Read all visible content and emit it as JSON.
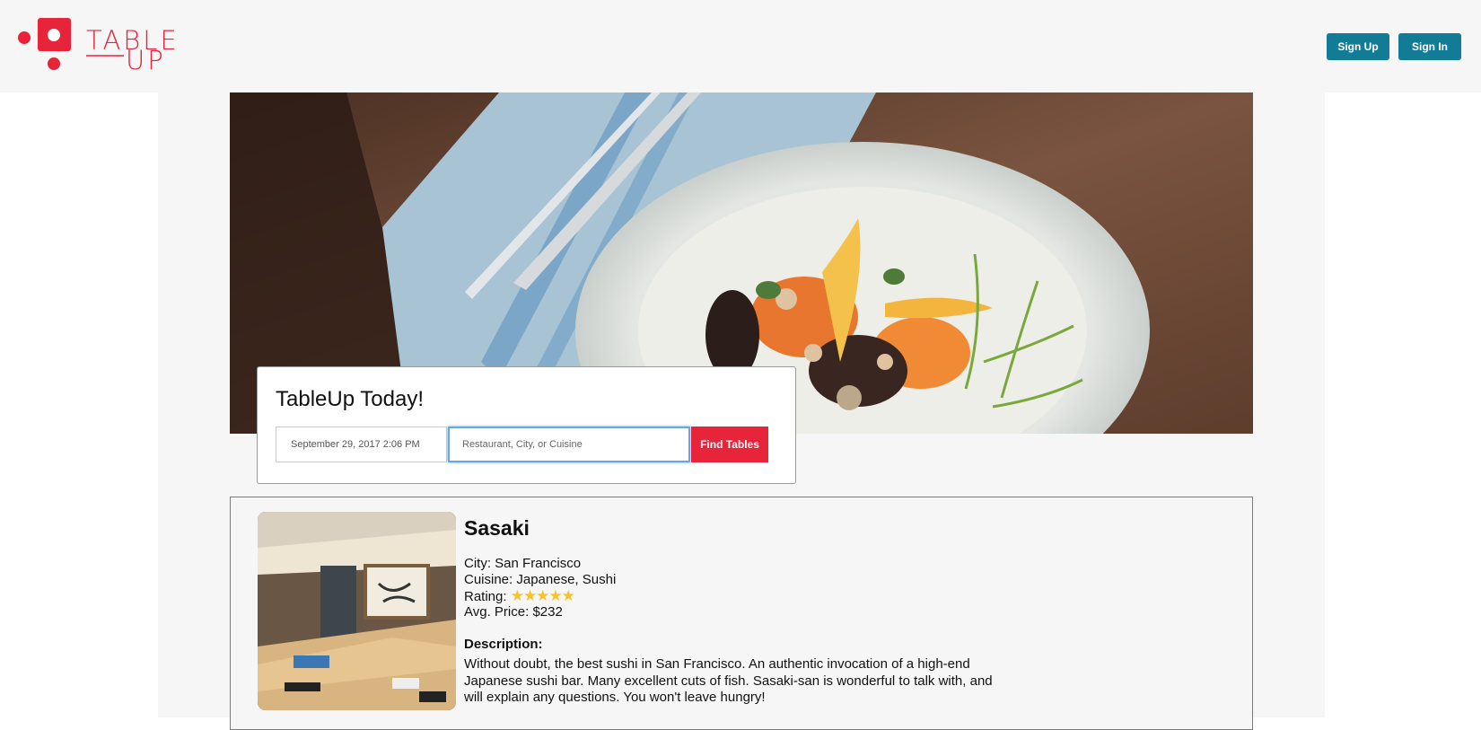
{
  "brand": {
    "logo_line1": "TABLE",
    "logo_line2": "UP",
    "accent": "#e8243a"
  },
  "header": {
    "signup_label": "Sign Up",
    "signin_label": "Sign In",
    "button_color": "#127c96"
  },
  "search": {
    "title": "TableUp Today!",
    "date_value": "September 29, 2017 2:06 PM",
    "query_placeholder": "Restaurant, City, or Cuisine",
    "query_value": "",
    "submit_label": "Find Tables"
  },
  "results": [
    {
      "name": "Sasaki",
      "city_label": "City:",
      "city": "San Francisco",
      "cuisine_label": "Cuisine:",
      "cuisine": "Japanese, Sushi",
      "rating_label": "Rating:",
      "rating_stars": "★★★★★",
      "rating_value": 5,
      "price_label": "Avg. Price:",
      "price": "$232",
      "description_label": "Description:",
      "description": "Without doubt, the best sushi in San Francisco. An authentic invocation of a high-end Japanese sushi bar. Many excellent cuts of fish. Sasaki-san is wonderful to talk with, and will explain any questions. You won't leave hungry!"
    }
  ]
}
